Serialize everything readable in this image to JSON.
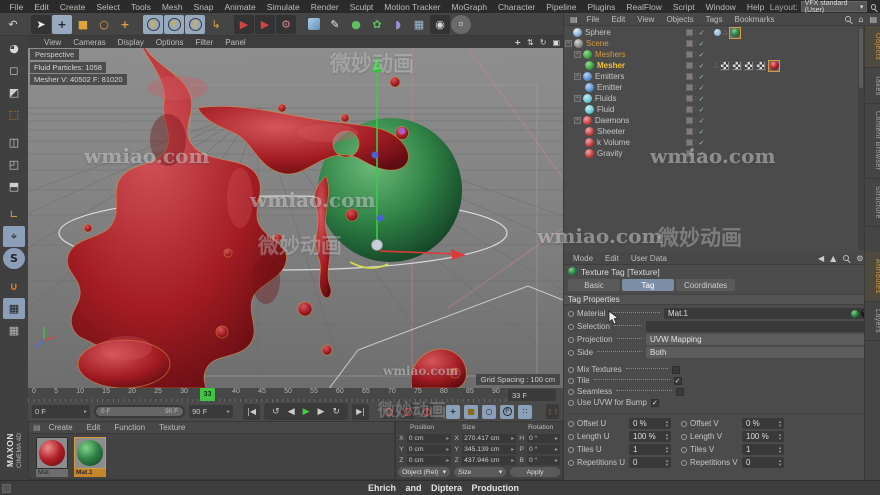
{
  "app": {
    "layout_label": "Layout:",
    "layout_value": "VFX standard (User)"
  },
  "menubar": {
    "items": [
      "File",
      "Edit",
      "Create",
      "Select",
      "Tools",
      "Mesh",
      "Snap",
      "Animate",
      "Simulate",
      "Render",
      "Sculpt",
      "Motion Tracker",
      "MoGraph",
      "Character",
      "Pipeline",
      "Plugins",
      "RealFlow",
      "Script",
      "Window",
      "Help"
    ]
  },
  "icons": {
    "undo": "↶",
    "cursor": "➤",
    "move": "+",
    "scale": "■",
    "rotate": "○",
    "snap": "+",
    "axis_x": "X",
    "axis_y": "Y",
    "axis_z": "Z",
    "coords": "↳",
    "render": "▶",
    "cube": "◼",
    "pen": "✎",
    "sphere": "●",
    "mograph": "✿",
    "metaball": "◗",
    "plane": "▦",
    "camera": "◉",
    "light": "￮",
    "home": "⌂",
    "panel": "▤",
    "gear": "⚙",
    "back": "◀",
    "up": "▲",
    "pan": "+",
    "dolly": "⇅",
    "orbit": "↻",
    "maximize": "▣",
    "goto_start": "|◀",
    "play_back": "↺",
    "prev": "◀",
    "play": "▶",
    "next": "▶",
    "loop": "↻",
    "goto_end": "▶|",
    "check": "✓",
    "dots": "∴",
    "expander": "−",
    "dropdown": "▾",
    "spin_left": "◂",
    "spin_right": "▸",
    "spin_up": "▲",
    "spin_down": "▼",
    "points": "∷",
    "p_key": "P",
    "film": "⋮⋮",
    "rec_q": "?"
  },
  "viewport": {
    "menu": [
      "View",
      "Cameras",
      "Display",
      "Options",
      "Filter",
      "Panel"
    ],
    "camera": "Perspective",
    "hud_particles": "Fluid Particles: 1058",
    "hud_mesher": "Mesher V: 40502 F: 81020",
    "grid_spacing": "Grid Spacing : 100 cm"
  },
  "watermarks": {
    "latin": "wmiao.com",
    "cjk": "微妙动画"
  },
  "object_manager": {
    "menu": [
      "File",
      "Edit",
      "View",
      "Objects",
      "Tags",
      "Bookmarks"
    ],
    "side_tabs": [
      "Objects",
      "Takes",
      "Content Browser",
      "Structure"
    ],
    "tree": [
      {
        "name": "Sphere"
      },
      {
        "name": "Scene"
      },
      {
        "name": "Meshers"
      },
      {
        "name": "Mesher"
      },
      {
        "name": "Emitters"
      },
      {
        "name": "Emitter"
      },
      {
        "name": "Fluids"
      },
      {
        "name": "Fluid"
      },
      {
        "name": "Daemons"
      },
      {
        "name": "Sheeter"
      },
      {
        "name": "k Volume"
      },
      {
        "name": "Gravity"
      }
    ]
  },
  "attributes": {
    "menu": [
      "Mode",
      "Edit",
      "User Data"
    ],
    "title": "Texture Tag [Texture]",
    "tabs": [
      "Basic",
      "Tag",
      "Coordinates"
    ],
    "section": "Tag Properties",
    "material_label": "Material",
    "material_value": "Mat.1",
    "selection_label": "Selection",
    "selection_value": "",
    "projection_label": "Projection",
    "projection_value": "UVW Mapping",
    "side_label": "Side",
    "side_value": "Both",
    "checks": [
      {
        "label": "Mix Textures",
        "mark": ""
      },
      {
        "label": "Tile",
        "mark": "✓"
      },
      {
        "label": "Seamless",
        "mark": ""
      },
      {
        "label": "Use UVW for Bump",
        "mark": "✓"
      }
    ],
    "uv": [
      {
        "l1": "Offset U",
        "v1": "0 %",
        "l2": "Offset V",
        "v2": "0 %"
      },
      {
        "l1": "Length U",
        "v1": "100 %",
        "l2": "Length V",
        "v2": "100 %"
      },
      {
        "l1": "Tiles U",
        "v1": "1",
        "l2": "Tiles V",
        "v2": "1"
      },
      {
        "l1": "Repetitions U",
        "v1": "0",
        "l2": "Repetitions V",
        "v2": "0"
      }
    ],
    "side_tabs": [
      "Attributes",
      "Layers"
    ]
  },
  "timeline": {
    "ticks": [
      "0",
      "5",
      "10",
      "15",
      "20",
      "25",
      "30",
      "35",
      "40",
      "45",
      "50",
      "55",
      "60",
      "65",
      "70",
      "75",
      "80",
      "85",
      "90"
    ],
    "playhead": "33",
    "frame_field": "33 F",
    "start_field": "0 F",
    "end_field": "90 F",
    "range_start": "0 F",
    "range_end": "90 F"
  },
  "materials": {
    "menu": [
      "Create",
      "Edit",
      "Function",
      "Texture"
    ],
    "items": [
      {
        "name": "Mat"
      },
      {
        "name": "Mat.1"
      }
    ],
    "brand_top": "MAXON",
    "brand_bottom": "CINEMA 4D"
  },
  "coordinates": {
    "headers": [
      "Position",
      "Size",
      "Rotation"
    ],
    "rows": [
      {
        "a": "X",
        "av": "0 cm",
        "b": "X",
        "bv": "270.417 cm",
        "c": "H",
        "cv": "0 °"
      },
      {
        "a": "Y",
        "av": "0 cm",
        "b": "Y",
        "bv": "345.139 cm",
        "c": "P",
        "cv": "0 °"
      },
      {
        "a": "Z",
        "av": "0 cm",
        "b": "Z",
        "bv": "437.946 cm",
        "c": "B",
        "cv": "0 °"
      }
    ],
    "mode": "Object (Rel)",
    "size_mode": "Size",
    "apply": "Apply"
  },
  "statusbar": {
    "credit": "Ehrich and Diptera Production"
  },
  "colors": {
    "accent_orange": "#d79b3c",
    "select_blue": "#97a9be",
    "tab_blue": "#7b8ea6",
    "playhead_green": "#43c243",
    "material_red": "#b32027",
    "material_green": "#2e8045"
  }
}
